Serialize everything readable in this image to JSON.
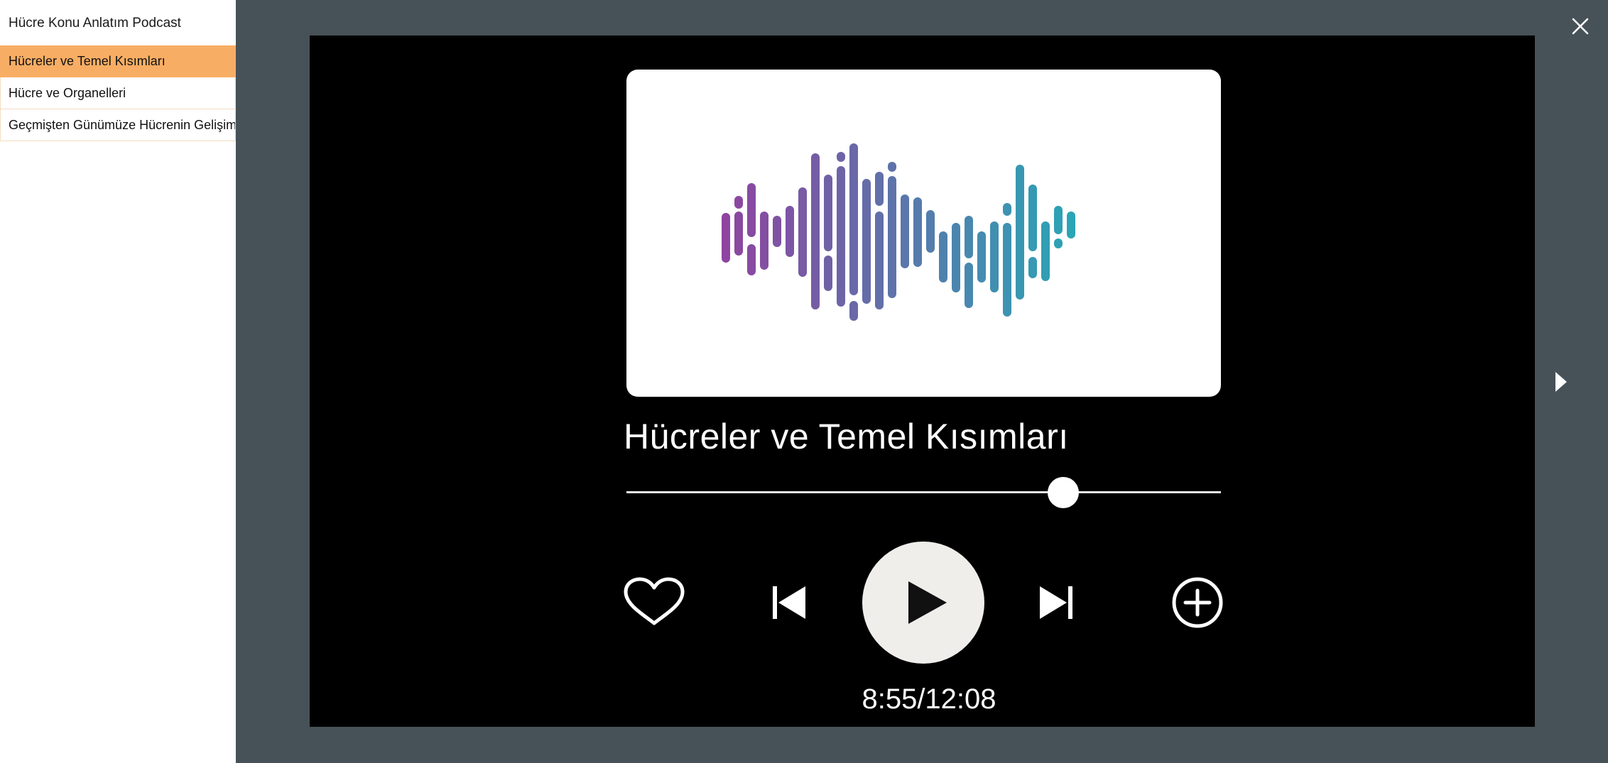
{
  "sidebar": {
    "title": "Hücre Konu Anlatım Podcast",
    "items": [
      {
        "label": "Hücreler ve Temel Kısımları",
        "active": true
      },
      {
        "label": "Hücre ve Organelleri",
        "active": false
      },
      {
        "label": "Geçmişten Günümüze Hücrenin Gelişimi",
        "active": false
      }
    ]
  },
  "player": {
    "title": "Hücreler ve Temel Kısımları",
    "elapsed": "8:55",
    "duration": "12:08",
    "time_display": "8:55/12:08",
    "progress_fraction": 0.735
  },
  "icons": {
    "close": "close-icon",
    "next_slide": "chevron-right-icon",
    "like": "heart-icon",
    "previous": "skip-previous-icon",
    "play": "play-icon",
    "next": "skip-next-icon",
    "add": "plus-circle-icon",
    "cover": "waveform-icon"
  },
  "colors": {
    "active_item": "#f8ad64",
    "viewer_bg": "#475258",
    "wave_start": "#8e44a0",
    "wave_end": "#2aa5b5"
  }
}
